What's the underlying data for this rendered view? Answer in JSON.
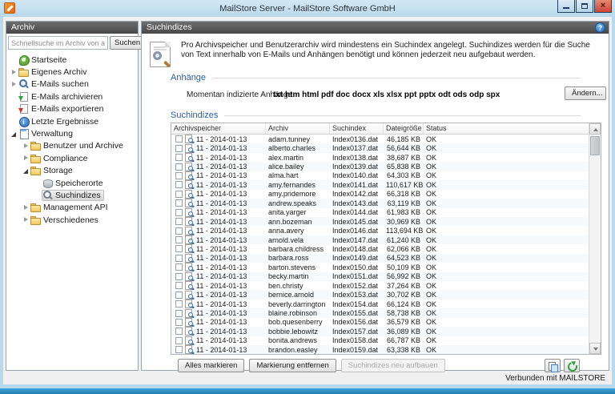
{
  "window": {
    "title": "MailStore Server - MailStore Software GmbH",
    "status": "Verbunden mit MAILSTORE"
  },
  "colors": {
    "titlebar_blue": "#b9d8ec",
    "window_border_blue": "#2f96cd",
    "panel_header_dark": "#474747",
    "section_accent_blue": "#215fa6",
    "close_button_red": "#cc4638"
  },
  "sidebar": {
    "header": "Archiv",
    "search": {
      "placeholder": "Schnellsuche im Archiv von admin",
      "button": "Suchen"
    },
    "tree": [
      {
        "label": "Startseite",
        "icon": "home-icon",
        "level": 0,
        "expander": "none",
        "selected": false
      },
      {
        "label": "Eigenes Archiv",
        "icon": "folder-icon",
        "level": 0,
        "expander": "collapsed",
        "selected": false
      },
      {
        "label": "E-Mails suchen",
        "icon": "search-icon",
        "level": 0,
        "expander": "collapsed",
        "selected": false
      },
      {
        "label": "E-Mails archivieren",
        "icon": "archive-icon",
        "level": 0,
        "expander": "none",
        "selected": false
      },
      {
        "label": "E-Mails exportieren",
        "icon": "export-icon",
        "level": 0,
        "expander": "none",
        "selected": false
      },
      {
        "label": "Letzte Ergebnisse",
        "icon": "results-icon",
        "level": 0,
        "expander": "none",
        "selected": false
      },
      {
        "label": "Verwaltung",
        "icon": "management-icon",
        "level": 0,
        "expander": "expanded",
        "selected": false
      },
      {
        "label": "Benutzer und Archive",
        "icon": "folder-icon",
        "level": 1,
        "expander": "collapsed",
        "selected": false
      },
      {
        "label": "Compliance",
        "icon": "folder-icon",
        "level": 1,
        "expander": "collapsed",
        "selected": false
      },
      {
        "label": "Storage",
        "icon": "folder-icon",
        "level": 1,
        "expander": "expanded",
        "selected": false
      },
      {
        "label": "Speicherorte",
        "icon": "storage-location-icon",
        "level": 2,
        "expander": "none",
        "selected": false
      },
      {
        "label": "Suchindizes",
        "icon": "search-index-icon",
        "level": 2,
        "expander": "none",
        "selected": true
      },
      {
        "label": "Management API",
        "icon": "folder-icon",
        "level": 1,
        "expander": "collapsed",
        "selected": false
      },
      {
        "label": "Verschiedenes",
        "icon": "folder-icon",
        "level": 1,
        "expander": "collapsed",
        "selected": false
      }
    ]
  },
  "main": {
    "header": "Suchindizes",
    "intro_text": "Pro Archivspeicher und Benutzerarchiv wird mindestens ein Suchindex angelegt. Suchindizes werden für die Suche von Text innerhalb von E-Mails und Anhängen benötigt und können jederzeit neu aufgebaut werden.",
    "attachments": {
      "title": "Anhänge",
      "label": "Momentan indizierte Anhänge:",
      "value": "txt htm html pdf doc docx xls xlsx ppt pptx odt ods odp spx",
      "change_button": "Ändern..."
    },
    "indexes": {
      "title": "Suchindizes",
      "columns": [
        "Archivspeicher",
        "Archiv",
        "Suchindex",
        "Dateigröße",
        "Status"
      ],
      "archive_store": "11 - 2014-01-13",
      "rows": [
        {
          "archiv": "adam.tunney",
          "suchindex": "Index0136.dat",
          "dateigroesse": "46,185 KB",
          "status": "OK"
        },
        {
          "archiv": "alberto.charles",
          "suchindex": "Index0137.dat",
          "dateigroesse": "56,644 KB",
          "status": "OK"
        },
        {
          "archiv": "alex.martin",
          "suchindex": "Index0138.dat",
          "dateigroesse": "38,687 KB",
          "status": "OK"
        },
        {
          "archiv": "alice.bailey",
          "suchindex": "Index0139.dat",
          "dateigroesse": "65,838 KB",
          "status": "OK"
        },
        {
          "archiv": "alma.hart",
          "suchindex": "Index0140.dat",
          "dateigroesse": "64,303 KB",
          "status": "OK"
        },
        {
          "archiv": "amy.fernandes",
          "suchindex": "Index0141.dat",
          "dateigroesse": "110,617 KB",
          "status": "OK"
        },
        {
          "archiv": "amy.pridemore",
          "suchindex": "Index0142.dat",
          "dateigroesse": "66,318 KB",
          "status": "OK"
        },
        {
          "archiv": "andrew.speaks",
          "suchindex": "Index0143.dat",
          "dateigroesse": "63,119 KB",
          "status": "OK"
        },
        {
          "archiv": "anita.yarger",
          "suchindex": "Index0144.dat",
          "dateigroesse": "61,983 KB",
          "status": "OK"
        },
        {
          "archiv": "ann.bozeman",
          "suchindex": "Index0145.dat",
          "dateigroesse": "30,969 KB",
          "status": "OK"
        },
        {
          "archiv": "anna.avery",
          "suchindex": "Index0146.dat",
          "dateigroesse": "113,694 KB",
          "status": "OK"
        },
        {
          "archiv": "arnold.vela",
          "suchindex": "Index0147.dat",
          "dateigroesse": "61,240 KB",
          "status": "OK"
        },
        {
          "archiv": "barbara.childress",
          "suchindex": "Index0148.dat",
          "dateigroesse": "62,066 KB",
          "status": "OK"
        },
        {
          "archiv": "barbara.ross",
          "suchindex": "Index0149.dat",
          "dateigroesse": "64,523 KB",
          "status": "OK"
        },
        {
          "archiv": "barton.stevens",
          "suchindex": "Index0150.dat",
          "dateigroesse": "50,109 KB",
          "status": "OK"
        },
        {
          "archiv": "becky.martin",
          "suchindex": "Index0151.dat",
          "dateigroesse": "56,992 KB",
          "status": "OK"
        },
        {
          "archiv": "ben.christy",
          "suchindex": "Index0152.dat",
          "dateigroesse": "37,264 KB",
          "status": "OK"
        },
        {
          "archiv": "bernice.arnold",
          "suchindex": "Index0153.dat",
          "dateigroesse": "30,702 KB",
          "status": "OK"
        },
        {
          "archiv": "beverly.darrington",
          "suchindex": "Index0154.dat",
          "dateigroesse": "66,124 KB",
          "status": "OK"
        },
        {
          "archiv": "blaine.robinson",
          "suchindex": "Index0155.dat",
          "dateigroesse": "58,738 KB",
          "status": "OK"
        },
        {
          "archiv": "bob.quesenberry",
          "suchindex": "Index0156.dat",
          "dateigroesse": "36,579 KB",
          "status": "OK"
        },
        {
          "archiv": "bobbie.lebowitz",
          "suchindex": "Index0157.dat",
          "dateigroesse": "36,089 KB",
          "status": "OK"
        },
        {
          "archiv": "bonita.andrews",
          "suchindex": "Index0158.dat",
          "dateigroesse": "66,787 KB",
          "status": "OK"
        },
        {
          "archiv": "brandon.easley",
          "suchindex": "Index0159.dat",
          "dateigroesse": "63,338 KB",
          "status": "OK"
        }
      ],
      "buttons": {
        "select_all": "Alles markieren",
        "clear_selection": "Markierung entfernen",
        "rebuild": "Suchindizes neu aufbauen"
      }
    }
  }
}
